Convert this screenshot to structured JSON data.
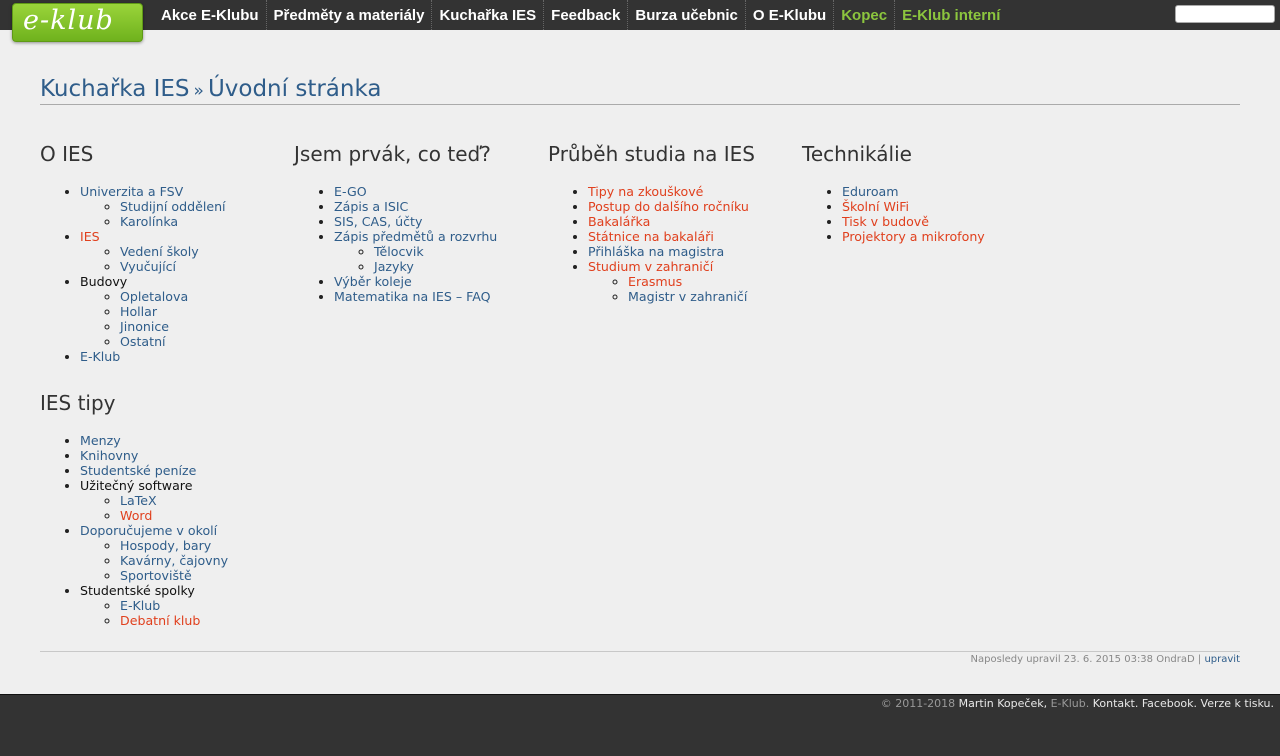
{
  "logo": {
    "text": "e-klub"
  },
  "nav": [
    {
      "label": "Akce E-Klubu"
    },
    {
      "label": "Předměty a materiály"
    },
    {
      "label": "Kuchařka IES"
    },
    {
      "label": "Feedback"
    },
    {
      "label": "Burza učebnic"
    },
    {
      "label": "O E-Klubu"
    },
    {
      "label": "Kopec"
    },
    {
      "label": "E-Klub interní"
    }
  ],
  "search": {
    "value": ""
  },
  "breadcrumb": {
    "root": "Kuchařka IES",
    "separator": "»",
    "current": "Úvodní stránka"
  },
  "sections": {
    "o_ies": {
      "title": "O IES",
      "items": [
        {
          "label": "Univerzita a FSV",
          "children": [
            "Studijní oddělení",
            "Karolínka"
          ]
        },
        {
          "label": "IES",
          "children": [
            "Vedení školy",
            "Vyučující"
          ]
        },
        {
          "label": "Budovy",
          "children": [
            "Opletalova",
            "Hollar",
            "Jinonice",
            "Ostatní"
          ]
        },
        {
          "label": "E-Klub"
        }
      ]
    },
    "ies_tipy": {
      "title": "IES tipy",
      "items": [
        {
          "label": "Menzy"
        },
        {
          "label": "Knihovny"
        },
        {
          "label": "Studentské peníze"
        },
        {
          "label": "Užitečný software",
          "children": [
            "LaTeX",
            "Word"
          ]
        },
        {
          "label": "Doporučujeme v okolí",
          "children": [
            "Hospody, bary",
            "Kavárny, čajovny",
            "Sportoviště"
          ]
        },
        {
          "label": "Studentské spolky",
          "children": [
            "E-Klub",
            "Debatní klub"
          ]
        }
      ]
    },
    "prvak": {
      "title": "Jsem prvák, co teď?",
      "items": [
        {
          "label": "E-GO"
        },
        {
          "label": "Zápis a ISIC"
        },
        {
          "label": "SIS, CAS, účty"
        },
        {
          "label": "Zápis předmětů a rozvrhu",
          "children": [
            "Tělocvik",
            "Jazyky"
          ]
        },
        {
          "label": "Výběr koleje"
        },
        {
          "label": "Matematika na IES – FAQ"
        }
      ]
    },
    "prubeh": {
      "title": "Průběh studia na IES",
      "items": [
        {
          "label": "Tipy na zkouškové"
        },
        {
          "label": "Postup do dalšího ročníku"
        },
        {
          "label": "Bakalářka"
        },
        {
          "label": "Státnice na bakaláři"
        },
        {
          "label": "Přihláška na magistra"
        },
        {
          "label": "Studium v zahraničí",
          "children": [
            "Erasmus",
            "Magistr v zahraničí"
          ]
        }
      ]
    },
    "technikalie": {
      "title": "Technikálie",
      "items": [
        {
          "label": "Eduroam"
        },
        {
          "label": "Školní WiFi"
        },
        {
          "label": "Tisk v budově"
        },
        {
          "label": "Projektory a mikrofony"
        }
      ]
    }
  },
  "footer": {
    "updated_text": "Naposledy upravil 23. 6. 2015 03:38 OndraD |",
    "edit_label": "upravit",
    "copyright": "© 2011-2018",
    "author": "Martin Kopeček,",
    "eklub": "E-Klub.",
    "kontakt": "Kontakt.",
    "facebook": "Facebook.",
    "print": "Verze k tisku."
  },
  "colors": {
    "link": "#2f5d8a",
    "new_page_red": "#e0401e",
    "bar": "#333333",
    "nav_green": "#8cc63e",
    "logo_green": "#7cbf25"
  }
}
